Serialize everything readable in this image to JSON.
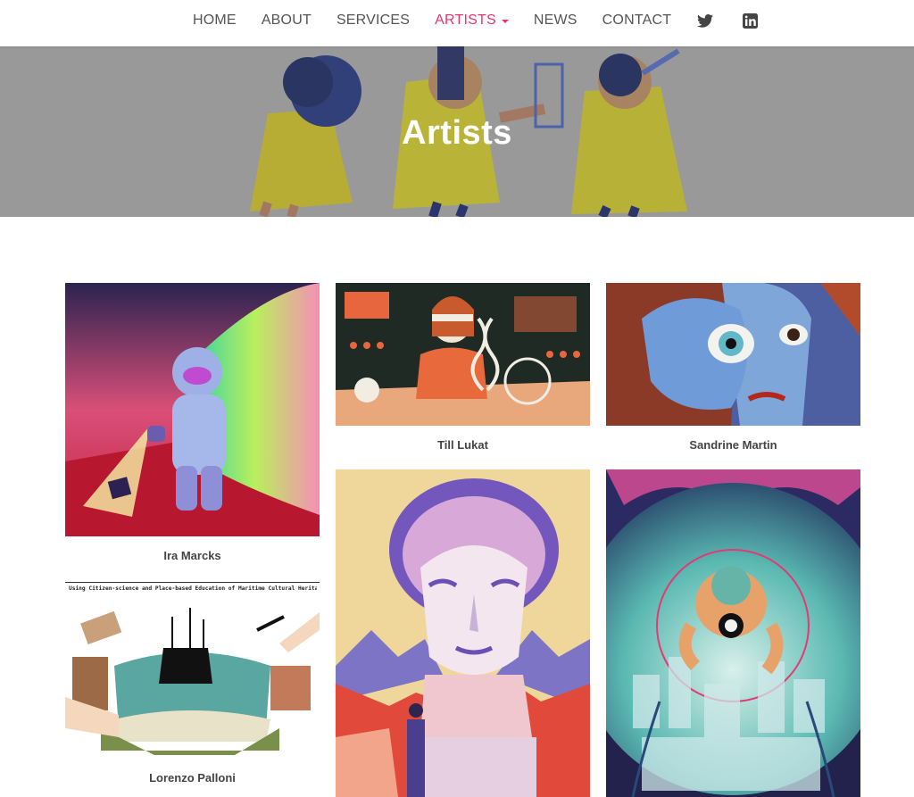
{
  "nav": {
    "items": [
      {
        "label": "HOME"
      },
      {
        "label": "ABOUT"
      },
      {
        "label": "SERVICES"
      },
      {
        "label": "ARTISTS"
      },
      {
        "label": "NEWS"
      },
      {
        "label": "CONTACT"
      }
    ],
    "social": [
      "twitter-icon",
      "linkedin-icon"
    ]
  },
  "hero": {
    "title": "Artists"
  },
  "artists": [
    {
      "name": "Ira Marcks"
    },
    {
      "name": "Till Lukat"
    },
    {
      "name": "Sandrine Martin"
    },
    {
      "name": "Lorenzo Palloni"
    },
    {
      "caption": "Using Citizen-science and Place-based Education of Maritime Cultural Heritage"
    }
  ],
  "colors": {
    "accent": "#e8336d",
    "text": "#555555",
    "name_text": "#444444"
  }
}
